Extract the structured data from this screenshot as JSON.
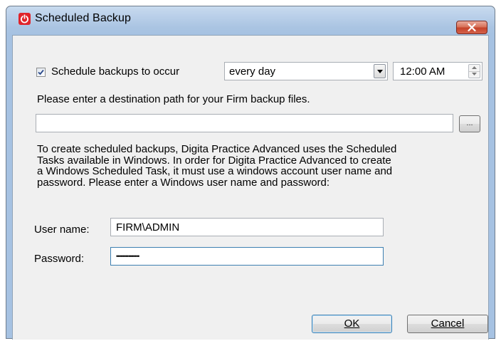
{
  "window": {
    "title": "Scheduled Backup"
  },
  "schedule": {
    "checkbox_label": "Schedule backups to occur",
    "checked": true,
    "frequency_value": "every day",
    "time_value": "12:00 AM"
  },
  "destination": {
    "prompt": "Please enter a destination path for your Firm backup files.",
    "path_value": "",
    "browse_label": "..."
  },
  "description": {
    "line1": "To create scheduled backups, Digita Practice Advanced uses the Scheduled",
    "line2": "Tasks available in Windows. In order for Digita Practice Advanced to create",
    "line3": "a Windows Scheduled Task, it must use a windows account user name and",
    "line4": "password. Please enter a Windows user name and password:"
  },
  "credentials": {
    "username_label": "User name:",
    "username_value": "FIRM\\ADMIN",
    "password_label": "Password:",
    "password_value": "•••••••••••••••"
  },
  "buttons": {
    "ok_label": "OK",
    "cancel_label": "Cancel"
  },
  "colors": {
    "accent_focus": "#3c7fb1",
    "titlebar": "#aac4e2",
    "close_button": "#c5432a",
    "app_icon": "#e0242a"
  },
  "icons": {
    "app": "power-icon",
    "close": "close-icon",
    "checkbox": "checkmark-icon",
    "dropdown": "chevron-down-icon",
    "spin_up": "spin-up-icon",
    "spin_down": "spin-down-icon"
  }
}
